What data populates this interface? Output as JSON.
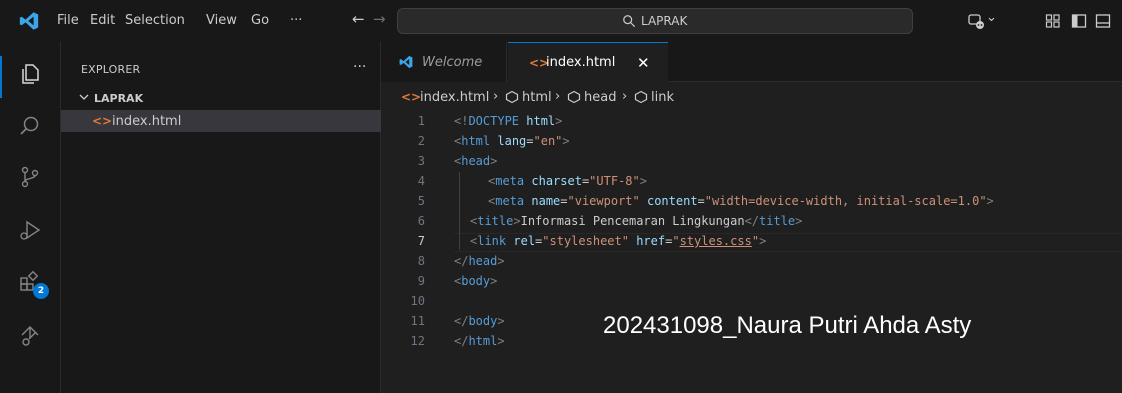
{
  "titlebar": {
    "menu": [
      "File",
      "Edit",
      "Selection",
      "View",
      "Go",
      "···"
    ],
    "back_arrow": "←",
    "forward_arrow": "→",
    "search_text": "LAPRAK",
    "copilot_chevron": "⌄"
  },
  "sidebar": {
    "header": "EXPLORER",
    "more": "···",
    "folder": "LAPRAK",
    "file_icon": "<>",
    "file": "index.html"
  },
  "activitybar": {
    "extensions_badge": "2"
  },
  "tabs": [
    {
      "label": "Welcome"
    },
    {
      "label": "index.html",
      "icon": "<>",
      "close": "✕"
    }
  ],
  "breadcrumb": {
    "file_icon": "<>",
    "file": "index.html",
    "sep": "›",
    "items": [
      "html",
      "head",
      "link"
    ]
  },
  "editor": {
    "line_numbers": [
      "1",
      "2",
      "3",
      "4",
      "5",
      "6",
      "7",
      "8",
      "9",
      "10",
      "11",
      "12"
    ],
    "active_line": "7"
  },
  "code": {
    "l1": {
      "open": "<!",
      "doctype": "DOCTYPE",
      "html": " html",
      "close": ">"
    },
    "l2": {
      "lt": "<",
      "tag": "html",
      "attr": " lang",
      "eq": "=",
      "val": "\"en\"",
      "gt": ">"
    },
    "l3": {
      "lt": "<",
      "tag": "head",
      "gt": ">"
    },
    "l4": {
      "lt": "<",
      "tag": "meta",
      "attr": " charset",
      "eq": "=",
      "val": "\"UTF-8\"",
      "gt": ">"
    },
    "l5": {
      "lt": "<",
      "tag": "meta",
      "attr1": " name",
      "eq1": "=",
      "val1": "\"viewport\"",
      "attr2": " content",
      "eq2": "=",
      "val2": "\"width=device-width, initial-scale=1.0\"",
      "gt": ">"
    },
    "l6": {
      "lt": "<",
      "tag": "title",
      "gt": ">",
      "text": "Informasi Pencemaran Lingkungan",
      "lt2": "</",
      "tag2": "title",
      "gt2": ">"
    },
    "l7": {
      "lt": "<",
      "tag": "link",
      "attr1": " rel",
      "eq1": "=",
      "val1": "\"stylesheet\"",
      "attr2": " href",
      "eq2": "=",
      "q1": "\"",
      "val2": "styles.css",
      "q2": "\"",
      "gt": ">"
    },
    "l8": {
      "lt": "</",
      "tag": "head",
      "gt": ">"
    },
    "l9": {
      "lt": "<",
      "tag": "body",
      "gt": ">"
    },
    "l11": {
      "lt": "</",
      "tag": "body",
      "gt": ">"
    },
    "l12": {
      "lt": "</",
      "tag": "html",
      "gt": ">"
    }
  },
  "overlay": {
    "text": "202431098_Naura Putri Ahda Asty"
  },
  "colors": {
    "accent": "#0078d4",
    "html_file_icon": "#e37933"
  }
}
